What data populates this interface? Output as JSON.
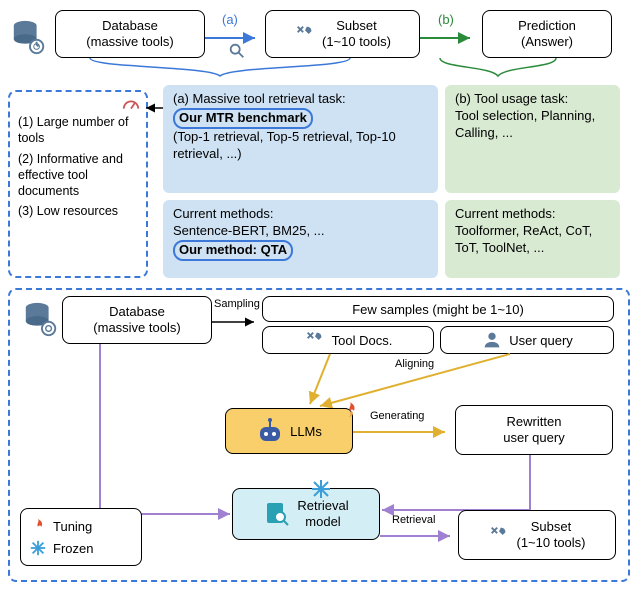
{
  "top": {
    "database": {
      "title": "Database",
      "sub": "(massive tools)"
    },
    "arrow_a": "(a)",
    "subset": {
      "title": "Subset",
      "sub": "(1~10 tools)"
    },
    "arrow_b": "(b)",
    "prediction": {
      "title": "Prediction",
      "sub": "(Answer)"
    }
  },
  "left_req": {
    "r1": "(1) Large number of tools",
    "r2": "(2) Informative and effective tool documents",
    "r3": "(3) Low resources"
  },
  "panel_a": {
    "heading": "(a) Massive tool retrieval task:",
    "our_bench": "Our MTR benchmark",
    "detail": "(Top-1 retrieval, Top-5 retrieval, Top-10 retrieval, ...)",
    "methods_label": "Current methods:",
    "methods_list": "Sentence-BERT, BM25, ...",
    "our_method": "Our method: QTA"
  },
  "panel_b": {
    "heading": "(b) Tool usage task:",
    "detail": "Tool selection, Planning, Calling, ...",
    "methods_label": "Current methods:",
    "methods_list": "Toolformer, ReAct, CoT, ToT, ToolNet, ..."
  },
  "flow": {
    "database": {
      "title": "Database",
      "sub": "(massive tools)"
    },
    "sampling": "Sampling",
    "few_samples": "Few samples (might be 1~10)",
    "tool_docs": "Tool Docs.",
    "user_query": "User query",
    "aligning": "Aligning",
    "llms": "LLMs",
    "generating": "Generating",
    "rewritten": {
      "l1": "Rewritten",
      "l2": "user query"
    },
    "retrieval_model": {
      "l1": "Retrieval",
      "l2": "model"
    },
    "retrieval_arrow": "Retrieval",
    "subset": {
      "title": "Subset",
      "sub": "(1~10 tools)"
    }
  },
  "legend": {
    "tuning": "Tuning",
    "frozen": "Frozen"
  }
}
